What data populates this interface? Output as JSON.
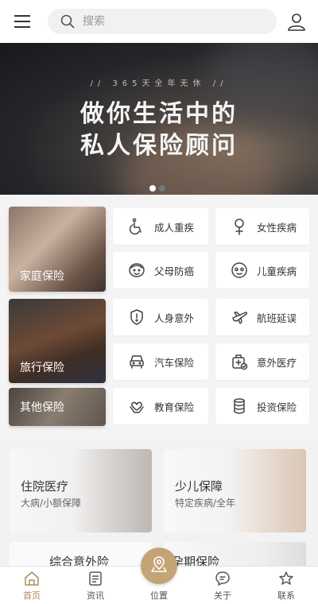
{
  "header": {
    "search_placeholder": "搜索",
    "menu_icon": "hamburger-menu-icon",
    "user_icon": "user-icon"
  },
  "banner": {
    "subtitle": "// 365天全年无休 //",
    "title_line1": "做你生活中的",
    "title_line2": "私人保险顾问",
    "slide_count": 2,
    "active_slide": 0
  },
  "categories": {
    "big": [
      {
        "label": "家庭保险"
      },
      {
        "label": "旅行保险"
      },
      {
        "label": "其他保险"
      }
    ],
    "small": [
      {
        "label": "成人重疾",
        "icon": "wheelchair-icon"
      },
      {
        "label": "女性疾病",
        "icon": "female-icon"
      },
      {
        "label": "父母防癌",
        "icon": "elder-face-icon"
      },
      {
        "label": "儿童疾病",
        "icon": "child-face-icon"
      },
      {
        "label": "人身意外",
        "icon": "shield-alert-icon"
      },
      {
        "label": "航班延误",
        "icon": "airplane-icon"
      },
      {
        "label": "汽车保险",
        "icon": "car-icon"
      },
      {
        "label": "意外医疗",
        "icon": "medical-kit-icon"
      },
      {
        "label": "教育保险",
        "icon": "heart-hands-icon"
      },
      {
        "label": "投资保险",
        "icon": "coins-icon"
      }
    ]
  },
  "features": [
    {
      "title": "住院医疗",
      "subtitle": "大病/小额保障"
    },
    {
      "title": "少儿保障",
      "subtitle": "特定疾病/全年"
    },
    {
      "title": "综合意外险"
    },
    {
      "title": "孕期保险"
    }
  ],
  "nav": {
    "items": [
      {
        "label": "首页",
        "icon": "home-icon",
        "active": true
      },
      {
        "label": "资讯",
        "icon": "news-icon"
      },
      {
        "label": "位置",
        "icon": "location-icon"
      },
      {
        "label": "关于",
        "icon": "chat-bubble-icon"
      },
      {
        "label": "联系",
        "icon": "star-icon"
      }
    ]
  },
  "colors": {
    "accent": "#c4a476",
    "active_nav": "#b08a5c",
    "page_bg": "#f4f4f4"
  }
}
